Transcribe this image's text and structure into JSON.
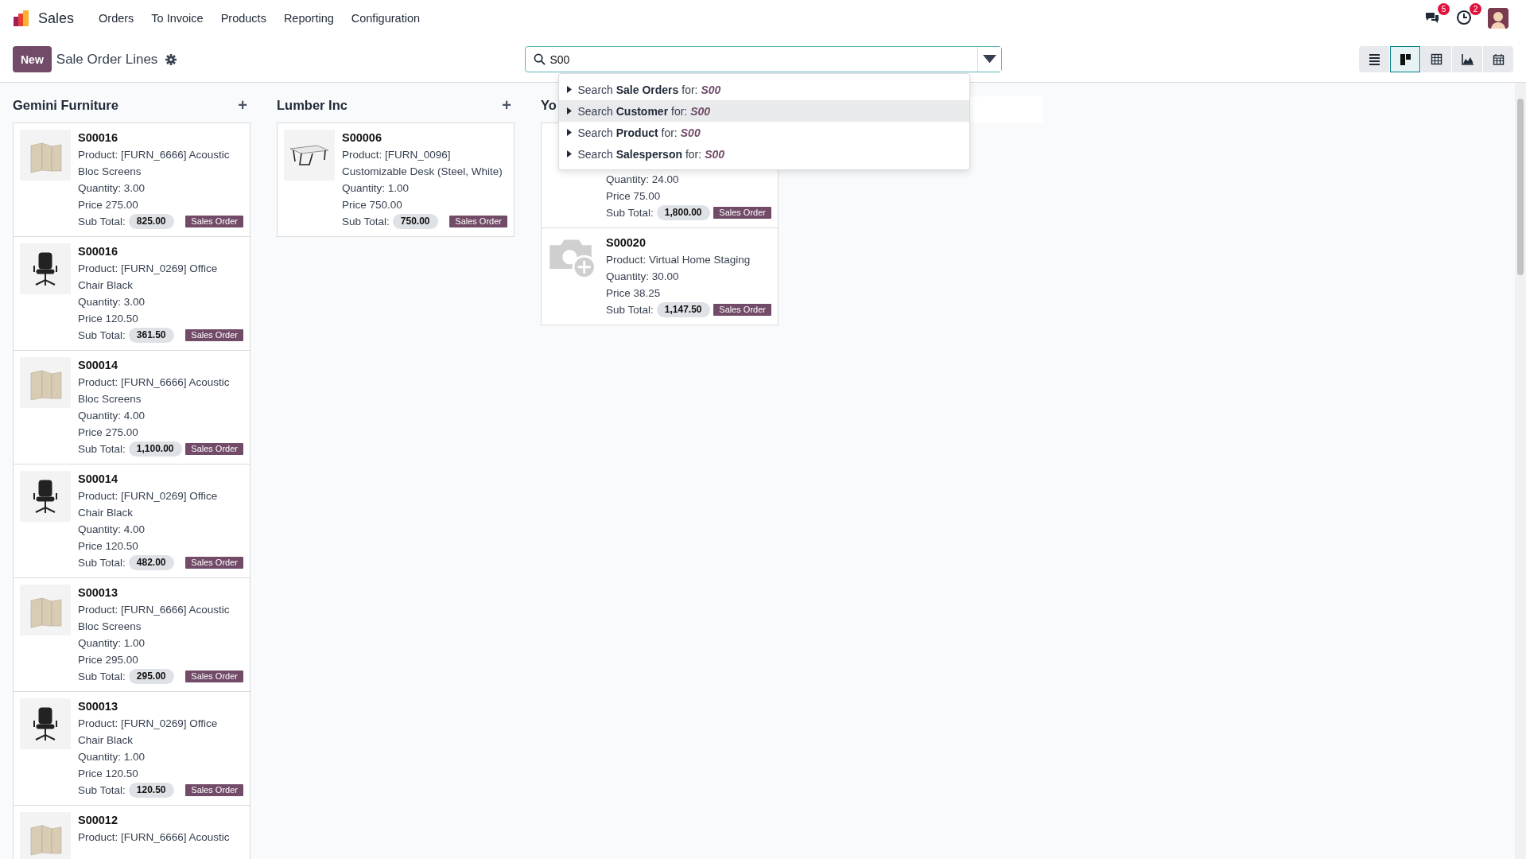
{
  "navbar": {
    "app_name": "Sales",
    "menu": [
      "Orders",
      "To Invoice",
      "Products",
      "Reporting",
      "Configuration"
    ],
    "messages_badge": "5",
    "activities_badge": "2"
  },
  "control_panel": {
    "new_button": "New",
    "title": "Sale Order Lines",
    "search": {
      "value": "S00"
    },
    "search_suggestions": [
      {
        "label": "Search **Sale Orders** for:",
        "term": "S00",
        "selected": false
      },
      {
        "label": "Search **Customer** for:",
        "term": "S00",
        "selected": true
      },
      {
        "label": "Search **Product** for:",
        "term": "S00",
        "selected": false
      },
      {
        "label": "Search **Salesperson** for:",
        "term": "S00",
        "selected": false
      }
    ],
    "views": [
      {
        "kind": "list",
        "selected": false
      },
      {
        "kind": "kanban",
        "selected": true
      },
      {
        "kind": "pivot",
        "selected": false
      },
      {
        "kind": "graph",
        "selected": false
      },
      {
        "kind": "calendar",
        "selected": false
      }
    ]
  },
  "columns": [
    {
      "title": "Gemini Furniture",
      "add": "+",
      "cards": [
        {
          "kind": "screens",
          "ref": "S00016",
          "product": "Product: [FURN_6666] Acoustic Bloc Screens",
          "quantity": "Quantity: 3.00",
          "price": "Price 275.00",
          "subtotal_label": "Sub Total:",
          "subtotal": "825.00",
          "tag": "Sales Order"
        },
        {
          "kind": "chair",
          "ref": "S00016",
          "product": "Product: [FURN_0269] Office Chair Black",
          "quantity": "Quantity: 3.00",
          "price": "Price 120.50",
          "subtotal_label": "Sub Total:",
          "subtotal": "361.50",
          "tag": "Sales Order"
        },
        {
          "kind": "screens",
          "ref": "S00014",
          "product": "Product: [FURN_6666] Acoustic Bloc Screens",
          "quantity": "Quantity: 4.00",
          "price": "Price 275.00",
          "subtotal_label": "Sub Total:",
          "subtotal": "1,100.00",
          "tag": "Sales Order"
        },
        {
          "kind": "chair",
          "ref": "S00014",
          "product": "Product: [FURN_0269] Office Chair Black",
          "quantity": "Quantity: 4.00",
          "price": "Price 120.50",
          "subtotal_label": "Sub Total:",
          "subtotal": "482.00",
          "tag": "Sales Order"
        },
        {
          "kind": "screens",
          "ref": "S00013",
          "product": "Product: [FURN_6666] Acoustic Bloc Screens",
          "quantity": "Quantity: 1.00",
          "price": "Price 295.00",
          "subtotal_label": "Sub Total:",
          "subtotal": "295.00",
          "tag": "Sales Order"
        },
        {
          "kind": "chair",
          "ref": "S00013",
          "product": "Product: [FURN_0269] Office Chair Black",
          "quantity": "Quantity: 1.00",
          "price": "Price 120.50",
          "subtotal_label": "Sub Total:",
          "subtotal": "120.50",
          "tag": "Sales Order"
        },
        {
          "kind": "screens",
          "ref": "S00012",
          "product": "Product: [FURN_6666] Acoustic"
        }
      ]
    },
    {
      "title": "Lumber Inc",
      "add": "+",
      "cards": [
        {
          "kind": "desk",
          "ref": "S00006",
          "product": "Product: [FURN_0096] Customizable Desk (Steel, White)",
          "quantity": "Quantity: 1.00",
          "price": "Price 750.00",
          "subtotal_label": "Sub Total:",
          "subtotal": "750.00",
          "tag": "Sales Order"
        }
      ]
    },
    {
      "title": "Yo",
      "cards": [
        {
          "quantity": "Quantity: 24.00",
          "price": "Price 75.00",
          "subtotal_label": "Sub Total:",
          "subtotal": "1,800.00",
          "tag": "Sales Order"
        },
        {
          "kind": "camera",
          "ref": "S00020",
          "product": "Product: Virtual Home Staging",
          "quantity": "Quantity: 30.00",
          "price": "Price 38.25",
          "subtotal_label": "Sub Total:",
          "subtotal": "1,147.50",
          "tag": "Sales Order"
        }
      ]
    }
  ]
}
